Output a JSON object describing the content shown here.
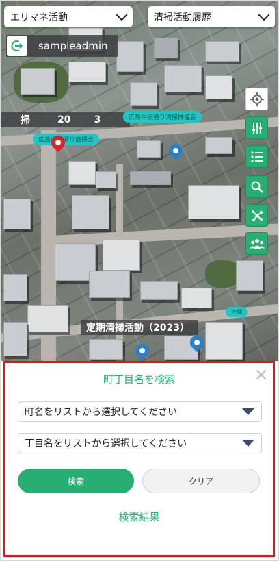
{
  "top_selects": {
    "left": {
      "value": "エリマネ活動"
    },
    "right": {
      "value": "清掃活動履歴"
    }
  },
  "user": {
    "name": "sampleadmin"
  },
  "map": {
    "band_label": {
      "c1": "掃",
      "c2": "20",
      "c3": "3"
    },
    "event_label": "定期清掃活動（2023）",
    "tags": [
      "広島中央通り清掃推進会",
      "広島中央通り清掃会"
    ]
  },
  "tools": [
    "location-icon",
    "filter-icon",
    "list-icon",
    "search-icon",
    "network-icon",
    "group-icon"
  ],
  "search_panel": {
    "title": "町丁目名を検索",
    "town_select": {
      "placeholder": "町名をリストから選択してください"
    },
    "chome_select": {
      "placeholder": "丁目名をリストから選択してください"
    },
    "search_button": "検索",
    "clear_button": "クリア",
    "results_label": "検索結果"
  },
  "colors": {
    "accent": "#26ae73",
    "highlight_border": "#e1141b",
    "tag": "#27c2c6"
  }
}
